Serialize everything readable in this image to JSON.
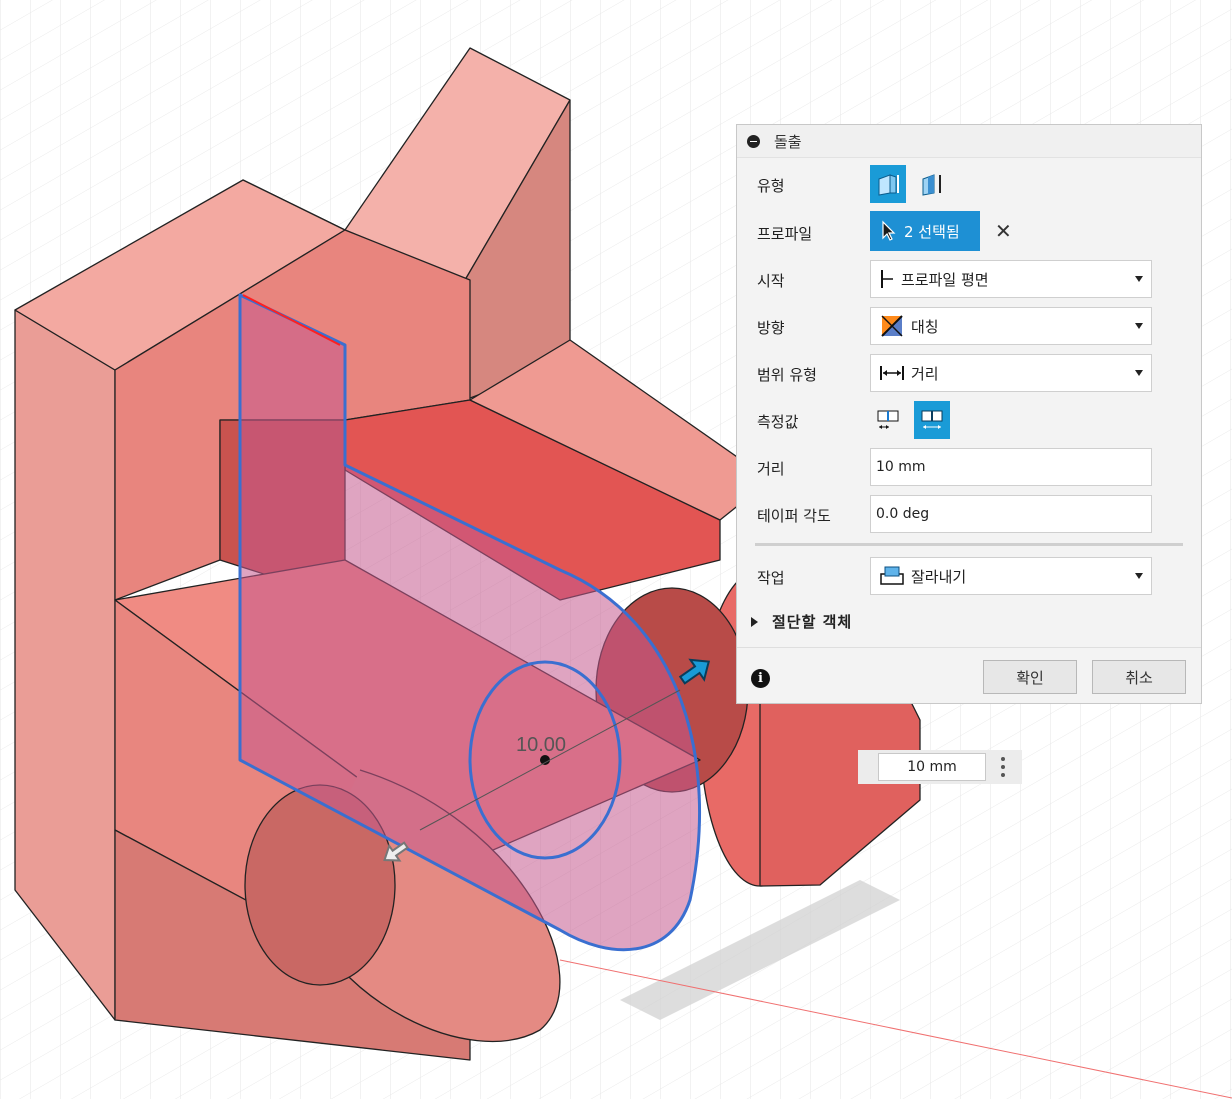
{
  "viewport": {
    "dimension_value": "10.00",
    "distance_widget": {
      "value": "10 mm"
    }
  },
  "dialog": {
    "title": "돌출",
    "type_label": "유형",
    "type_icons": [
      "new-body-extrude-icon",
      "thin-extrude-icon"
    ],
    "profile_label": "프로파일",
    "profile_value": "2 선택됨",
    "start_label": "시작",
    "start_value": "프로파일 평면",
    "direction_label": "방향",
    "direction_value": "대칭",
    "extent_type_label": "범위 유형",
    "extent_type_value": "거리",
    "measurement_label": "측정값",
    "measurement_icons": [
      "half-length-icon",
      "whole-length-icon"
    ],
    "distance_label": "거리",
    "distance_value": "10 mm",
    "taper_label": "테이퍼 각도",
    "taper_value": "0.0 deg",
    "operation_label": "작업",
    "operation_value": "잘라내기",
    "objects_to_cut_label": "절단할 객체",
    "ok_label": "확인",
    "cancel_label": "취소"
  },
  "colors": {
    "accent": "#1e90d4",
    "body_light": "#f3a8a0",
    "body_mid": "#e57a74",
    "body_dark": "#d94a48",
    "sketch_profile": "#c76a97",
    "selection_blue": "#3a6fd0"
  }
}
